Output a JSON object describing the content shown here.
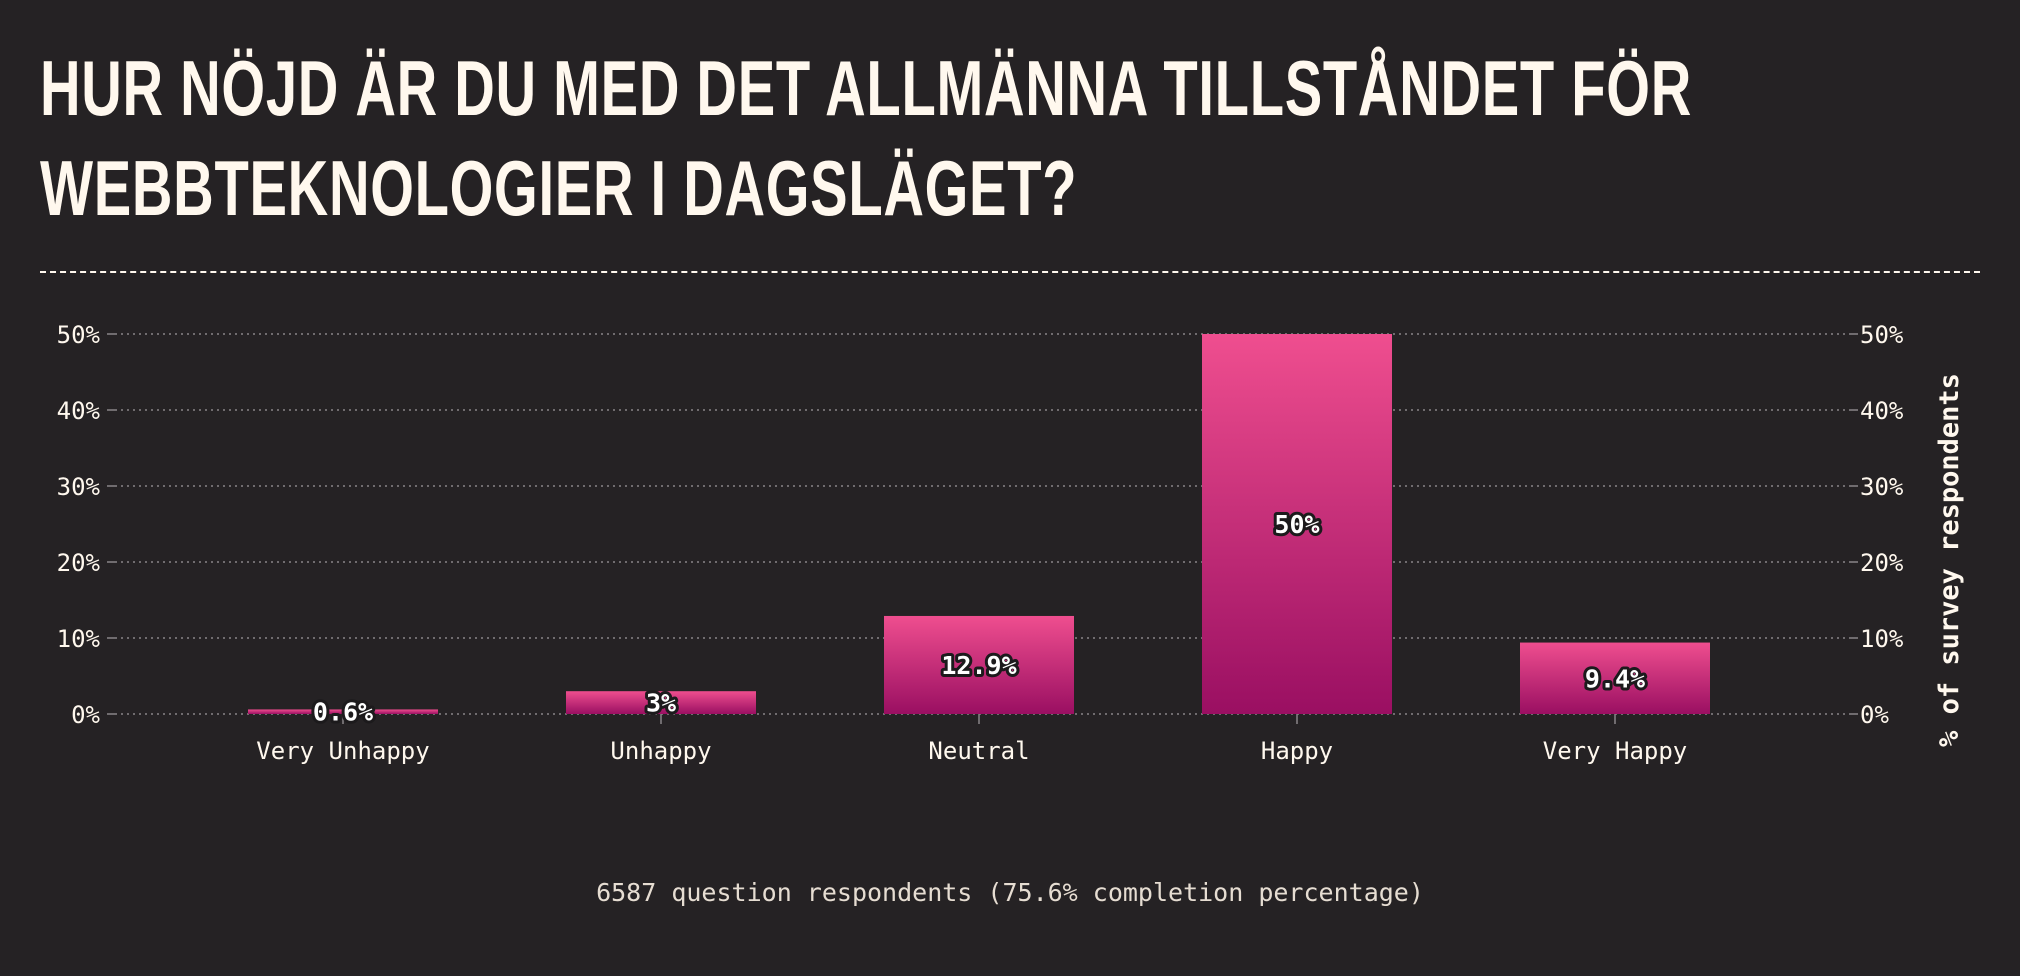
{
  "page": {
    "title_line1": "HUR NÖJD ÄR DU MED DET ALLMÄNNA TILLSTÅNDET FÖR",
    "title_line2": "WEBBTEKNOLOGIER I DAGSLÄGET?",
    "footer": "6587 question respondents (75.6% completion percentage)"
  },
  "colors": {
    "background": "#252224",
    "text": "#fff8ee",
    "bar_top": "#ef4e8f",
    "bar_bottom": "#9a0f62",
    "grid": "#8a8488"
  },
  "chart_data": {
    "type": "bar",
    "title": "HUR NÖJD ÄR DU MED DET ALLMÄNNA TILLSTÅNDET FÖR WEBBTEKNOLOGIER I DAGSLÄGET?",
    "categories": [
      "Very Unhappy",
      "Unhappy",
      "Neutral",
      "Happy",
      "Very Happy"
    ],
    "values": [
      0.6,
      3,
      12.9,
      50,
      9.4
    ],
    "value_labels": [
      "0.6%",
      "3%",
      "12.9%",
      "50%",
      "9.4%"
    ],
    "xlabel": "",
    "ylabel": "% of survey respondents",
    "ylim": [
      0,
      50
    ],
    "yticks": [
      0,
      10,
      20,
      30,
      40,
      50
    ],
    "ytick_labels": [
      "0%",
      "10%",
      "20%",
      "30%",
      "40%",
      "50%"
    ],
    "grid": true,
    "axes": "left and right"
  }
}
